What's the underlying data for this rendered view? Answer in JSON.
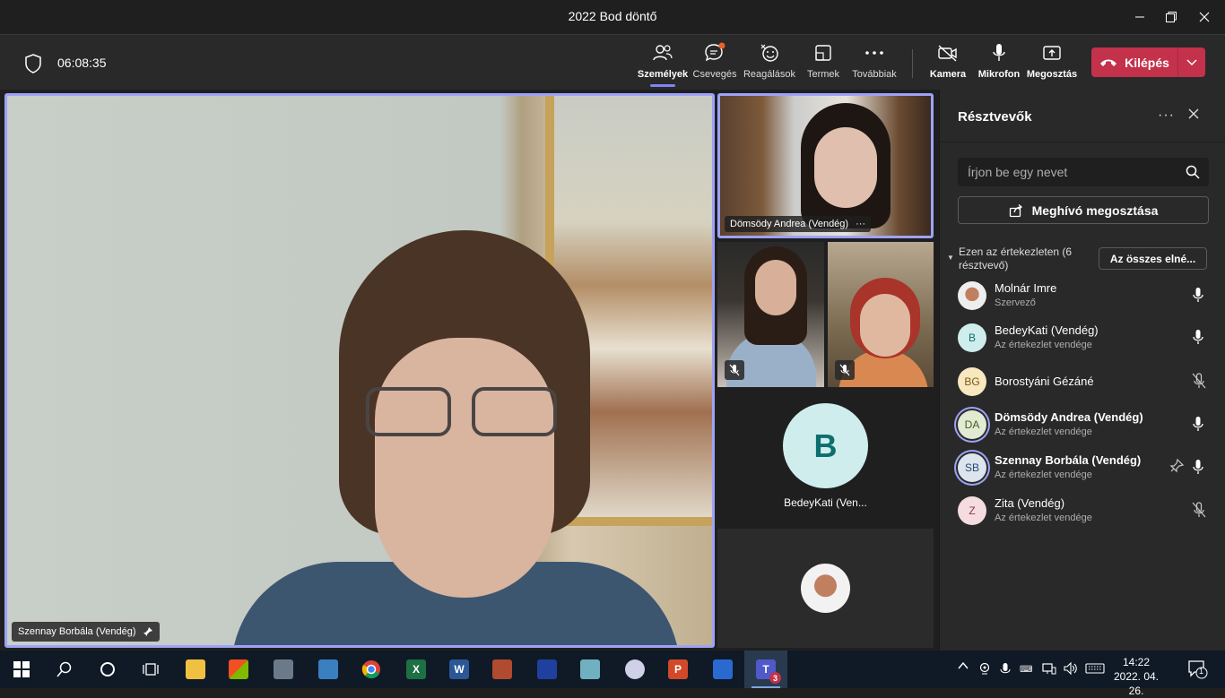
{
  "window": {
    "title": "2022 Bod döntő"
  },
  "toolbar": {
    "timer": "06:08:35",
    "people": "Személyek",
    "chat": "Csevegés",
    "reactions": "Reagálások",
    "rooms": "Termek",
    "more": "Továbbiak",
    "camera": "Kamera",
    "mic": "Mikrofon",
    "share": "Megosztás",
    "leave": "Kilépés"
  },
  "stage": {
    "main_name": "Szennay Borbála (Vendég)",
    "andrea_name": "Dömsödy Andrea (Vendég)",
    "b_initial": "B",
    "b_name": "BedeyKati (Ven..."
  },
  "panel": {
    "title": "Résztvevők",
    "search_placeholder": "Írjon be egy nevet",
    "invite": "Meghívó megosztása",
    "section_title": "Ezen az értekezleten (6 résztvevő)",
    "mute_all": "Az összes elné...",
    "participants": [
      {
        "name": "Molnár Imre",
        "sub": "Szervező",
        "initials": "",
        "mic": "on"
      },
      {
        "name": "BedeyKati (Vendég)",
        "sub": "Az értekezlet vendége",
        "initials": "B",
        "mic": "on"
      },
      {
        "name": "Borostyáni Gézáné",
        "sub": "",
        "initials": "BG",
        "mic": "off"
      },
      {
        "name": "Dömsödy Andrea (Vendég)",
        "sub": "Az értekezlet vendége",
        "initials": "DA",
        "mic": "on"
      },
      {
        "name": "Szennay Borbála (Vendég)",
        "sub": "Az értekezlet vendége",
        "initials": "SB",
        "mic": "on"
      },
      {
        "name": "Zita (Vendég)",
        "sub": "Az értekezlet vendége",
        "initials": "Z",
        "mic": "off"
      }
    ]
  },
  "taskbar": {
    "clock_time": "14:22",
    "clock_date": "2022. 04. 26.",
    "teams_badge": "3",
    "notif_count": "1"
  },
  "colors": {
    "accent": "#9da2f7",
    "leave": "#c4314b",
    "panel_bg": "#292929"
  }
}
